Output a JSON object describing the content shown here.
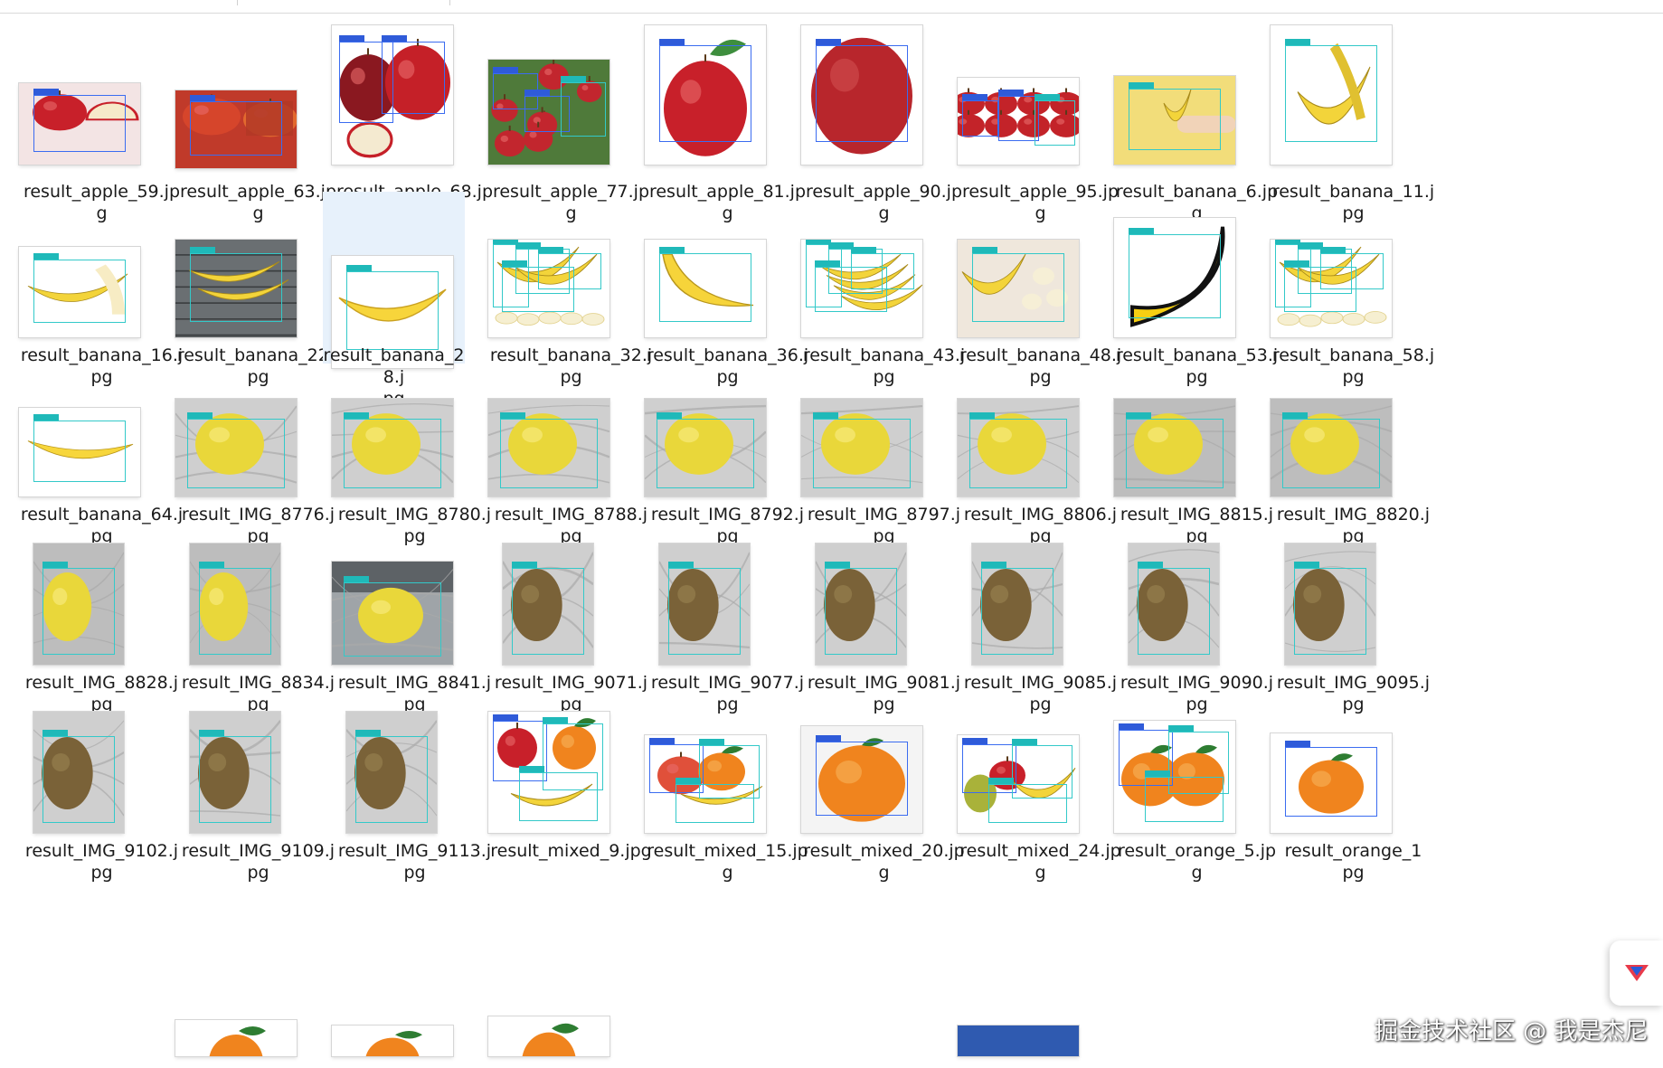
{
  "watermark": "掘金技术社区 @ 我是杰尼",
  "colors": {
    "selection": "#e7f1fb",
    "bbox_blue": "#3b6cf0",
    "bbox_cyan": "#33c9c9"
  },
  "rows": [
    [
      {
        "l1": "result_apple_59.jp",
        "l2": "g",
        "kind": "apple-cut",
        "bg": "#f3e4e4"
      },
      {
        "l1": "result_apple_63.jp",
        "l2": "g",
        "kind": "apple-poster",
        "bg": "#c03a2a"
      },
      {
        "l1": "result_apple_68.jp",
        "l2": "g",
        "kind": "apple-group",
        "bg": "#ffffff"
      },
      {
        "l1": "result_apple_77.jp",
        "l2": "g",
        "kind": "apple-tree",
        "bg": "#4f7a3a"
      },
      {
        "l1": "result_apple_81.jp",
        "l2": "g",
        "kind": "apple-single",
        "bg": "#ffffff"
      },
      {
        "l1": "result_apple_90.jp",
        "l2": "g",
        "kind": "apple-big",
        "bg": "#ffffff"
      },
      {
        "l1": "result_apple_95.jp",
        "l2": "g",
        "kind": "apple-many",
        "bg": "#ffffff"
      },
      {
        "l1": "result_banana_6.jp",
        "l2": "g",
        "kind": "banana-hand",
        "bg": "#f2dd7a"
      },
      {
        "l1": "result_banana_11.j",
        "l2": "pg",
        "kind": "banana-cartoon",
        "bg": "#ffffff"
      }
    ],
    [
      {
        "l1": "result_banana_16.j",
        "l2": "pg",
        "kind": "banana-peeled",
        "bg": "#ffffff"
      },
      {
        "l1": "result_banana_22.j",
        "l2": "pg",
        "kind": "banana-wood",
        "bg": "#5a5f62"
      },
      {
        "l1": "result_banana_28.j",
        "l2": "pg",
        "kind": "banana-single",
        "bg": "#ffffff",
        "selected": true
      },
      {
        "l1": "result_banana_32.j",
        "l2": "pg",
        "kind": "banana-bunch-slices",
        "bg": "#ffffff"
      },
      {
        "l1": "result_banana_36.j",
        "l2": "pg",
        "kind": "banana-curve",
        "bg": "#ffffff"
      },
      {
        "l1": "result_banana_43.j",
        "l2": "pg",
        "kind": "banana-bunch",
        "bg": "#ffffff"
      },
      {
        "l1": "result_banana_48.j",
        "l2": "pg",
        "kind": "banana-slices",
        "bg": "#efe7dc"
      },
      {
        "l1": "result_banana_53.j",
        "l2": "pg",
        "kind": "banana-big-cartoon",
        "bg": "#ffffff"
      },
      {
        "l1": "result_banana_58.j",
        "l2": "pg",
        "kind": "banana-bunch-slices",
        "bg": "#ffffff"
      }
    ],
    [
      {
        "l1": "result_banana_64.j",
        "l2": "pg",
        "kind": "banana-lying",
        "bg": "#ffffff"
      },
      {
        "l1": "result_IMG_8776.j",
        "l2": "pg",
        "kind": "lemon",
        "bg": "#cfcfcf"
      },
      {
        "l1": "result_IMG_8780.j",
        "l2": "pg",
        "kind": "lemon",
        "bg": "#cfcfcf"
      },
      {
        "l1": "result_IMG_8788.j",
        "l2": "pg",
        "kind": "lemon",
        "bg": "#cfcfcf"
      },
      {
        "l1": "result_IMG_8792.j",
        "l2": "pg",
        "kind": "lemon",
        "bg": "#cfcfcf"
      },
      {
        "l1": "result_IMG_8797.j",
        "l2": "pg",
        "kind": "lemon",
        "bg": "#cfcfcf"
      },
      {
        "l1": "result_IMG_8806.j",
        "l2": "pg",
        "kind": "lemon",
        "bg": "#cfcfcf"
      },
      {
        "l1": "result_IMG_8815.j",
        "l2": "pg",
        "kind": "lemon",
        "bg": "#bdbdbd"
      },
      {
        "l1": "result_IMG_8820.j",
        "l2": "pg",
        "kind": "lemon",
        "bg": "#bdbdbd"
      }
    ],
    [
      {
        "l1": "result_IMG_8828.j",
        "l2": "pg",
        "kind": "lemon-tall",
        "bg": "#bdbdbd"
      },
      {
        "l1": "result_IMG_8834.j",
        "l2": "pg",
        "kind": "lemon-tall",
        "bg": "#bdbdbd"
      },
      {
        "l1": "result_IMG_8841.j",
        "l2": "pg",
        "kind": "lemon-wide",
        "bg": "#9fa4a8"
      },
      {
        "l1": "result_IMG_9071.j",
        "l2": "pg",
        "kind": "kiwi",
        "bg": "#cfcfcf"
      },
      {
        "l1": "result_IMG_9077.j",
        "l2": "pg",
        "kind": "kiwi",
        "bg": "#cfcfcf"
      },
      {
        "l1": "result_IMG_9081.j",
        "l2": "pg",
        "kind": "kiwi",
        "bg": "#cfcfcf"
      },
      {
        "l1": "result_IMG_9085.j",
        "l2": "pg",
        "kind": "kiwi",
        "bg": "#cfcfcf"
      },
      {
        "l1": "result_IMG_9090.j",
        "l2": "pg",
        "kind": "kiwi",
        "bg": "#cfcfcf"
      },
      {
        "l1": "result_IMG_9095.j",
        "l2": "pg",
        "kind": "kiwi",
        "bg": "#cfcfcf"
      }
    ],
    [
      {
        "l1": "result_IMG_9102.j",
        "l2": "pg",
        "kind": "kiwi",
        "bg": "#cfcfcf"
      },
      {
        "l1": "result_IMG_9109.j",
        "l2": "pg",
        "kind": "kiwi",
        "bg": "#cfcfcf"
      },
      {
        "l1": "result_IMG_9113.j",
        "l2": "pg",
        "kind": "kiwi",
        "bg": "#cfcfcf"
      },
      {
        "l1": "result_mixed_9.jpg",
        "l2": "",
        "kind": "mixed-shutter",
        "bg": "#ffffff"
      },
      {
        "l1": "result_mixed_15.jp",
        "l2": "g",
        "kind": "mixed-fruits",
        "bg": "#ffffff"
      },
      {
        "l1": "result_mixed_20.jp",
        "l2": "g",
        "kind": "orange-leaf",
        "bg": "#f4f4f4"
      },
      {
        "l1": "result_mixed_24.jp",
        "l2": "g",
        "kind": "mixed-pear",
        "bg": "#ffffff"
      },
      {
        "l1": "result_orange_5.jp",
        "l2": "g",
        "kind": "orange-pair",
        "bg": "#ffffff"
      },
      {
        "l1": "result_orange_1",
        "l2": "pg",
        "kind": "orange-single",
        "bg": "#ffffff"
      }
    ]
  ],
  "partial_row": [
    {
      "kind": "orange-partial",
      "bg": "#ffffff"
    },
    {
      "kind": "orange-partial",
      "bg": "#ffffff"
    },
    {
      "kind": "orange-partial-2",
      "bg": "#ffffff"
    },
    {
      "kind": "blue-partial",
      "bg": "#2f5ab0"
    }
  ]
}
